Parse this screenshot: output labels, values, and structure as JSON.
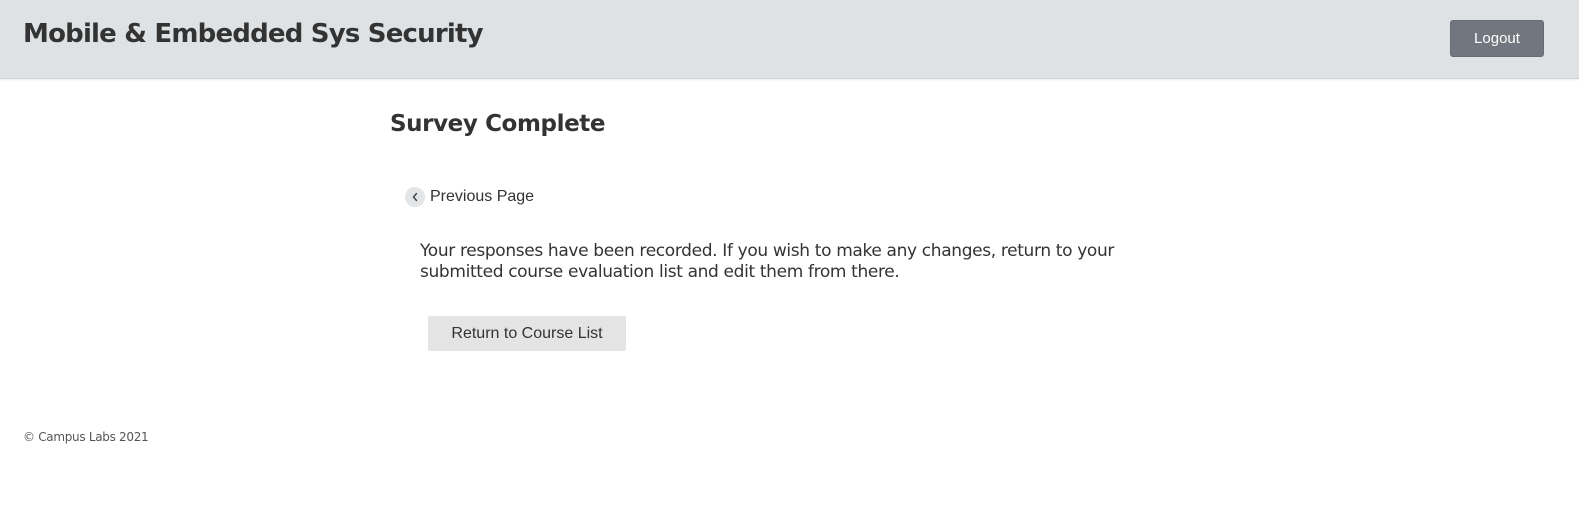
{
  "header": {
    "course_title": "Mobile & Embedded Sys Security",
    "logout_label": "Logout"
  },
  "main": {
    "page_title": "Survey Complete",
    "previous_page_label": "Previous Page",
    "previous_page_icon": "chevron-left-icon",
    "message": "Your responses have been recorded. If you wish to make any changes, return to your submitted course evaluation list and edit them from there.",
    "return_button_label": "Return to Course List"
  },
  "footer": {
    "copyright": "© Campus Labs 2021"
  },
  "colors": {
    "header_bg": "#dfe2e4",
    "logout_bg": "#72777f",
    "return_button_bg": "#e4e4e4",
    "text": "#333333"
  }
}
